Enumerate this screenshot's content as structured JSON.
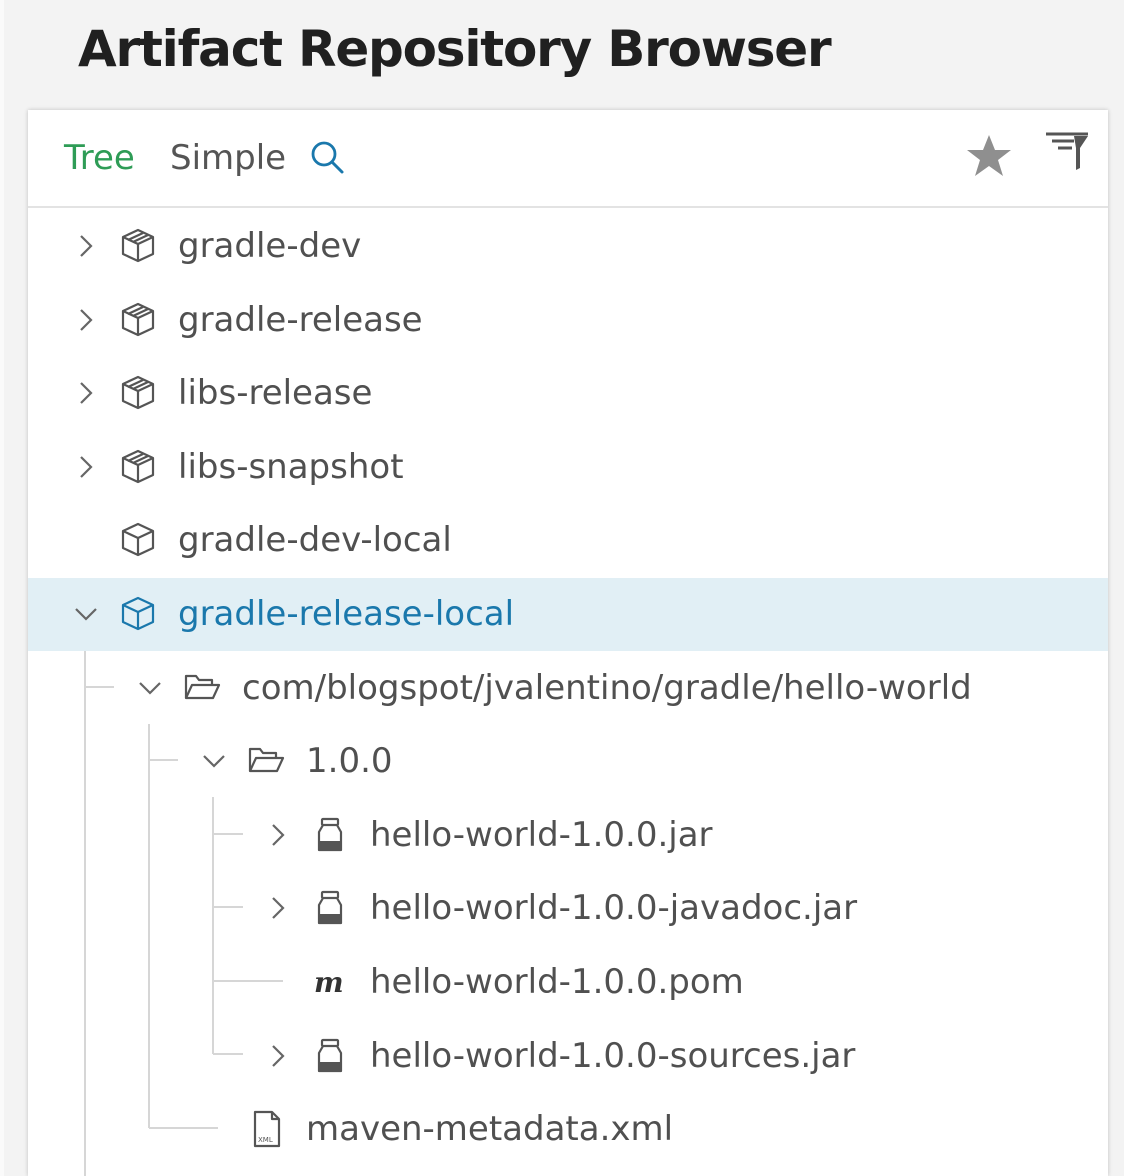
{
  "page": {
    "title": "Artifact Repository Browser"
  },
  "toolbar": {
    "tabs": [
      {
        "label": "Tree",
        "active": true
      },
      {
        "label": "Simple",
        "active": false
      }
    ],
    "icons": [
      "search-icon",
      "star-icon",
      "filter-icon"
    ]
  },
  "colors": {
    "active_tab": "#2e9c56",
    "selected_row_bg": "#e1eff5",
    "selected_text": "#1a78ac"
  },
  "tree": {
    "items": [
      {
        "label": "gradle-dev",
        "icon": "virtual-repo-icon",
        "chevron": "collapsed"
      },
      {
        "label": "gradle-release",
        "icon": "virtual-repo-icon",
        "chevron": "collapsed"
      },
      {
        "label": "libs-release",
        "icon": "virtual-repo-icon",
        "chevron": "collapsed"
      },
      {
        "label": "libs-snapshot",
        "icon": "virtual-repo-icon",
        "chevron": "collapsed"
      },
      {
        "label": "gradle-dev-local",
        "icon": "local-repo-icon",
        "chevron": "none"
      },
      {
        "label": "gradle-release-local",
        "icon": "local-repo-icon",
        "chevron": "expanded",
        "selected": true
      },
      {
        "label": "com/blogspot/jvalentino/gradle/hello-world",
        "icon": "folder-open-icon",
        "chevron": "expanded"
      },
      {
        "label": "1.0.0",
        "icon": "folder-open-icon",
        "chevron": "expanded"
      },
      {
        "label": "hello-world-1.0.0.jar",
        "icon": "jar-icon",
        "chevron": "collapsed"
      },
      {
        "label": "hello-world-1.0.0-javadoc.jar",
        "icon": "jar-icon",
        "chevron": "collapsed"
      },
      {
        "label": "hello-world-1.0.0.pom",
        "icon": "maven-pom-icon",
        "chevron": "none"
      },
      {
        "label": "hello-world-1.0.0-sources.jar",
        "icon": "jar-icon",
        "chevron": "collapsed"
      },
      {
        "label": "maven-metadata.xml",
        "icon": "xml-file-icon",
        "chevron": "none"
      }
    ]
  }
}
